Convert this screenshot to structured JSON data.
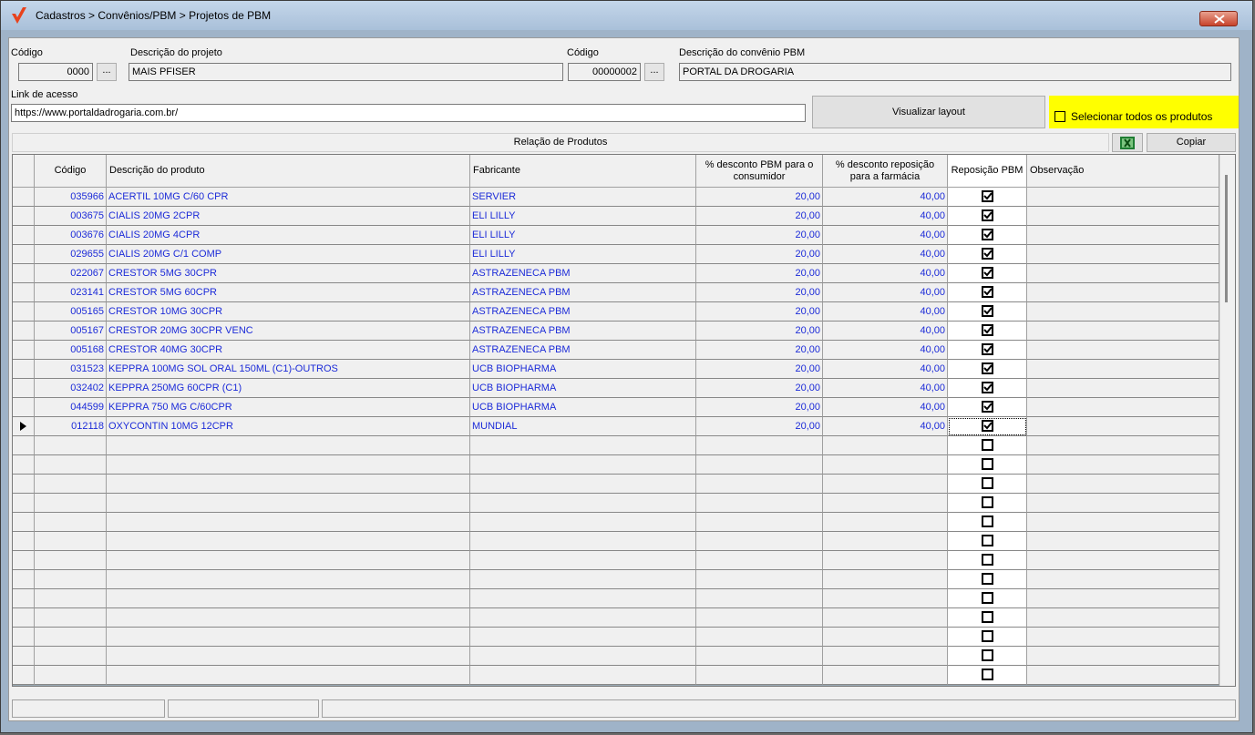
{
  "window": {
    "title": "Cadastros > Convênios/PBM > Projetos de PBM"
  },
  "project": {
    "code_label": "Código",
    "code_value": "0000",
    "code_lookup_label": "...",
    "desc_label": "Descrição do projeto",
    "desc_value": "MAIS PFISER"
  },
  "convenio": {
    "code_label": "Código",
    "code_value": "00000002",
    "code_lookup_label": "...",
    "desc_label": "Descrição do convênio PBM",
    "desc_value": "PORTAL DA DROGARIA"
  },
  "link": {
    "label": "Link de acesso",
    "value": "https://www.portaldadrogaria.com.br/"
  },
  "actions": {
    "view_layout": "Visualizar layout",
    "select_all": "Selecionar todos os produtos",
    "copy": "Copiar"
  },
  "section_title": "Relação de Produtos",
  "columns": {
    "code": "Código",
    "description": "Descrição do produto",
    "manufacturer": "Fabricante",
    "discount_consumer": "% desconto PBM para o consumidor",
    "discount_pharmacy": "% desconto reposição para a farmácia",
    "replenishment": "Reposição PBM",
    "notes": "Observação"
  },
  "products": [
    {
      "code": "035966",
      "description": "ACERTIL 10MG C/60 CPR",
      "manufacturer": "SERVIER",
      "discount_consumer": "20,00",
      "discount_pharmacy": "40,00",
      "replenishment": true
    },
    {
      "code": "003675",
      "description": "CIALIS 20MG 2CPR",
      "manufacturer": "ELI LILLY",
      "discount_consumer": "20,00",
      "discount_pharmacy": "40,00",
      "replenishment": true
    },
    {
      "code": "003676",
      "description": "CIALIS 20MG 4CPR",
      "manufacturer": "ELI LILLY",
      "discount_consumer": "20,00",
      "discount_pharmacy": "40,00",
      "replenishment": true
    },
    {
      "code": "029655",
      "description": "CIALIS 20MG C/1 COMP",
      "manufacturer": "ELI LILLY",
      "discount_consumer": "20,00",
      "discount_pharmacy": "40,00",
      "replenishment": true
    },
    {
      "code": "022067",
      "description": "CRESTOR  5MG 30CPR",
      "manufacturer": "ASTRAZENECA PBM",
      "discount_consumer": "20,00",
      "discount_pharmacy": "40,00",
      "replenishment": true
    },
    {
      "code": "023141",
      "description": "CRESTOR  5MG 60CPR",
      "manufacturer": "ASTRAZENECA PBM",
      "discount_consumer": "20,00",
      "discount_pharmacy": "40,00",
      "replenishment": true
    },
    {
      "code": "005165",
      "description": "CRESTOR 10MG 30CPR",
      "manufacturer": "ASTRAZENECA PBM",
      "discount_consumer": "20,00",
      "discount_pharmacy": "40,00",
      "replenishment": true
    },
    {
      "code": "005167",
      "description": "CRESTOR 20MG 30CPR VENC",
      "manufacturer": "ASTRAZENECA PBM",
      "discount_consumer": "20,00",
      "discount_pharmacy": "40,00",
      "replenishment": true
    },
    {
      "code": "005168",
      "description": "CRESTOR 40MG 30CPR",
      "manufacturer": "ASTRAZENECA PBM",
      "discount_consumer": "20,00",
      "discount_pharmacy": "40,00",
      "replenishment": true
    },
    {
      "code": "031523",
      "description": "KEPPRA 100MG SOL ORAL 150ML (C1)-OUTROS",
      "manufacturer": "UCB BIOPHARMA",
      "discount_consumer": "20,00",
      "discount_pharmacy": "40,00",
      "replenishment": true
    },
    {
      "code": "032402",
      "description": "KEPPRA 250MG 60CPR (C1)",
      "manufacturer": "UCB BIOPHARMA",
      "discount_consumer": "20,00",
      "discount_pharmacy": "40,00",
      "replenishment": true
    },
    {
      "code": "044599",
      "description": "KEPPRA 750 MG C/60CPR",
      "manufacturer": "UCB BIOPHARMA",
      "discount_consumer": "20,00",
      "discount_pharmacy": "40,00",
      "replenishment": true
    },
    {
      "code": "012118",
      "description": "OXYCONTIN 10MG  12CPR",
      "manufacturer": "MUNDIAL",
      "discount_consumer": "20,00",
      "discount_pharmacy": "40,00",
      "replenishment": true,
      "current": true
    }
  ]
}
